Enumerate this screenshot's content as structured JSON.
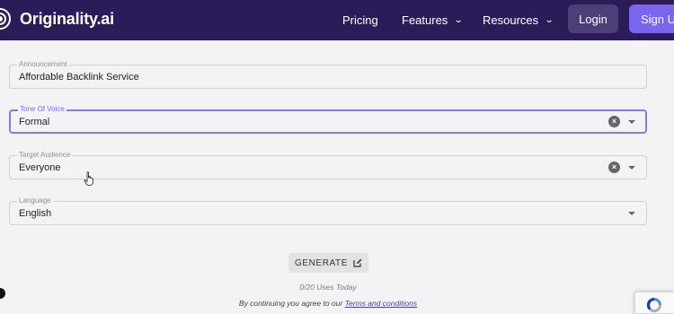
{
  "header": {
    "brand": "Originality.ai",
    "nav": [
      {
        "label": "Pricing",
        "has_dropdown": false
      },
      {
        "label": "Features",
        "has_dropdown": true
      },
      {
        "label": "Resources",
        "has_dropdown": true
      }
    ],
    "login_label": "Login",
    "signup_label": "Sign Up",
    "colors": {
      "background": "#2c1b59",
      "login_button": "#4c3f79",
      "signup_button": "#7a65f0"
    }
  },
  "form": {
    "announcement": {
      "label": "Announcement",
      "value": "Affordable Backlink Service"
    },
    "tone": {
      "label": "Tone Of Voice",
      "value": "Formal"
    },
    "audience": {
      "label": "Target Audience",
      "value": "Everyone"
    },
    "language": {
      "label": "Language",
      "value": "English"
    },
    "focus_color": "#8a78e6"
  },
  "generate": {
    "label": "GENERATE",
    "icon": "edit-icon",
    "uses": "0/20 Uses Today",
    "terms_prefix": "By continuing you agree to our",
    "terms_link": "Terms and conditions"
  }
}
